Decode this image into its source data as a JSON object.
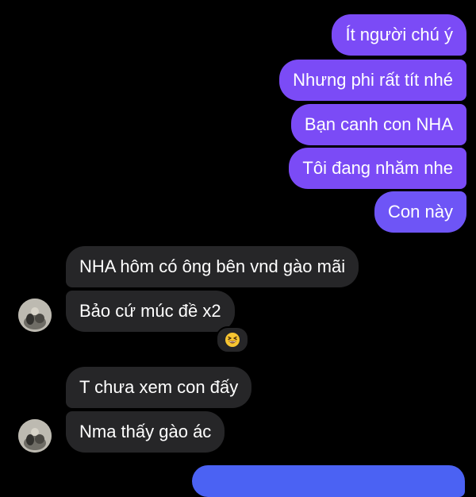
{
  "messages": {
    "outgoing": [
      {
        "text": "Ít người chú ý"
      },
      {
        "text": "Nhưng phi rất tít nhé"
      },
      {
        "text": "Bạn canh con NHA"
      },
      {
        "text": "Tôi đang nhăm nhe"
      },
      {
        "text": "Con này"
      }
    ],
    "incoming": [
      {
        "text": "NHA hôm có ông bên vnd gào mãi"
      },
      {
        "text": "Bảo cứ múc đề x2"
      },
      {
        "text": "T chưa xem con đấy"
      },
      {
        "text": "Nma thấy gào ác"
      }
    ],
    "reaction": {
      "emoji_name": "grinning-squinting-face-icon"
    }
  },
  "colors": {
    "background": "#000000",
    "outgoing_bubble": "#7b4bf6",
    "incoming_bubble": "#262628",
    "text": "#ffffff"
  }
}
